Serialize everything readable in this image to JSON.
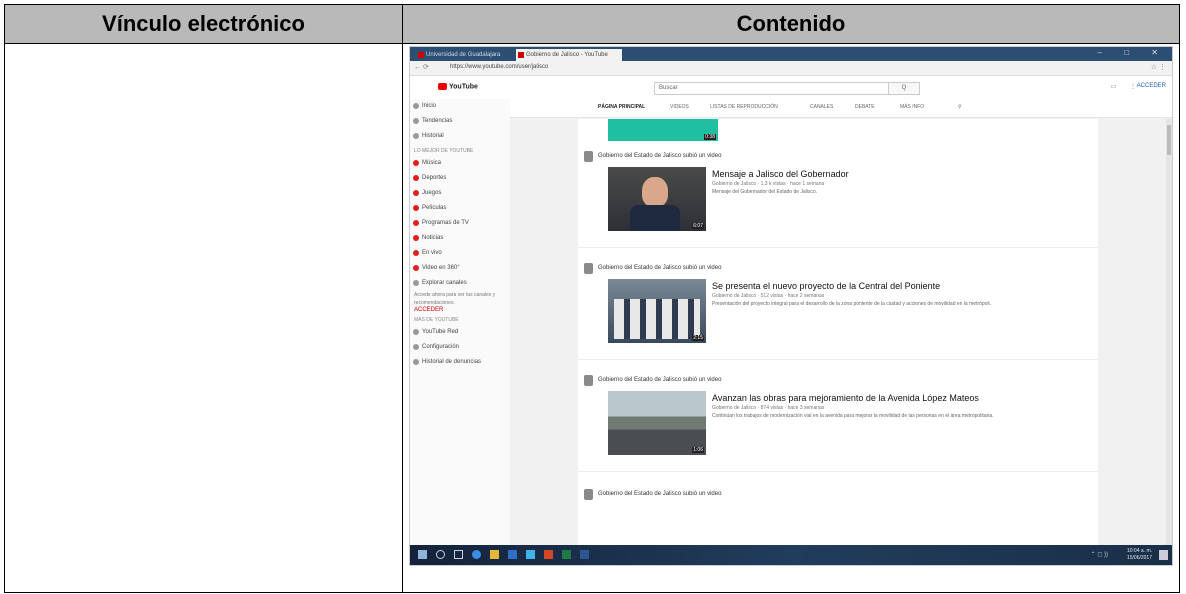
{
  "table": {
    "col1_header": "Vínculo electrónico",
    "col2_header": "Contenido",
    "col1_body": ""
  },
  "screenshot": {
    "browser": {
      "tabs": [
        {
          "label": "Universidad de Guadalajara"
        },
        {
          "label": "Gobierno de Jalisco - YouTube"
        }
      ],
      "window_controls": "–  □  ✕",
      "nav": "←  ⟳",
      "url": "https://www.youtube.com/user/jalisco",
      "ext_icons": "☆  ⋮"
    },
    "youtube_header": {
      "logo_text": "YouTube",
      "search_placeholder": "Buscar",
      "search_button": "Q",
      "icons": "▭  ⋮",
      "signin": "ACCEDER"
    },
    "sidebar": {
      "top_items": [
        {
          "label": "Inicio"
        },
        {
          "label": "Tendencias"
        },
        {
          "label": "Historial"
        }
      ],
      "best_section": "LO MEJOR DE YOUTUBE",
      "best_items": [
        {
          "label": "Música"
        },
        {
          "label": "Deportes"
        },
        {
          "label": "Juegos"
        },
        {
          "label": "Películas"
        },
        {
          "label": "Programas de TV"
        },
        {
          "label": "Noticias"
        },
        {
          "label": "En vivo"
        },
        {
          "label": "Video en 360°"
        }
      ],
      "browse": "Explorar canales",
      "signin_text": "Accede ahora para ver tus canales y recomendaciones.",
      "signin_link": "ACCEDER",
      "more_section": "MÁS DE YOUTUBE",
      "more_items": [
        {
          "label": "YouTube Red"
        },
        {
          "label": "Configuración"
        },
        {
          "label": "Historial de denuncias"
        }
      ]
    },
    "channel_tabs": [
      "PÁGINA PRINCIPAL",
      "VIDEOS",
      "LISTAS DE REPRODUCCIÓN",
      "CANALES",
      "DEBATE",
      "MÁS INFO"
    ],
    "top_thumb_duration": "0:38",
    "posts": [
      {
        "channel": "Gobierno del Estado de Jalisco subió un video",
        "title": "Mensaje a Jalisco del Gobernador",
        "meta": "Gobierno de Jalisco · 1,3 k vistas · hace 1 semana",
        "desc": "Mensaje del Gobernador del Estado de Jalisco.",
        "duration": "6:07"
      },
      {
        "channel": "Gobierno del Estado de Jalisco subió un video",
        "title": "Se presenta el nuevo proyecto de la Central del Poniente",
        "meta": "Gobierno de Jalisco · 512 vistas · hace 2 semanas",
        "desc": "Presentación del proyecto integral para el desarrollo de la zona poniente de la ciudad y acciones de movilidad en la metrópoli.",
        "duration": "2:15"
      },
      {
        "channel": "Gobierno del Estado de Jalisco subió un video",
        "title": "Avanzan las obras para mejoramiento de la Avenida López Mateos",
        "meta": "Gobierno de Jalisco · 874 vistas · hace 3 semanas",
        "desc": "Continúan los trabajos de modernización vial en la avenida para mejorar la movilidad de las personas en el área metropolitana.",
        "duration": "1:06"
      },
      {
        "channel": "Gobierno del Estado de Jalisco subió un video",
        "title": "",
        "meta": "",
        "desc": "",
        "duration": ""
      }
    ],
    "taskbar": {
      "tray": "⌃  ◻  ))",
      "clock_time": "10:04 a. m.",
      "clock_date": "15/06/2017"
    }
  }
}
